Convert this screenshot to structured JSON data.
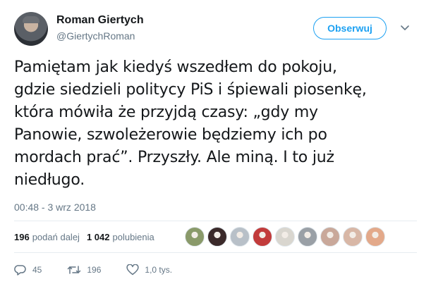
{
  "author": {
    "display_name": "Roman Giertych",
    "screen_name": "@GiertychRoman"
  },
  "follow_button": {
    "label": "Obserwuj"
  },
  "tweet": {
    "text": "Pamiętam jak kiedyś wszedłem do pokoju,\ngdzie siedzieli politycy PiS i śpiewali piosenkę,\nktóra mówiła że przyjdą czasy: „gdy my\nPanowie, szwoleżerowie będziemy ich po\nmordach prać”. Przyszły. Ale miną. I to już\nniedługo.",
    "timestamp": "00:48 - 3 wrz 2018"
  },
  "stats": {
    "retweets_count": "196",
    "retweets_label": "podań dalej",
    "likes_count": "1 042",
    "likes_label": "polubienia"
  },
  "likers": [
    {
      "color": "#8a9a6a"
    },
    {
      "color": "#3b2a2a"
    },
    {
      "color": "#b8c0c8"
    },
    {
      "color": "#c23b3b"
    },
    {
      "color": "#d9d6cf"
    },
    {
      "color": "#9aa0a6"
    },
    {
      "color": "#c9a89a"
    },
    {
      "color": "#d8b7a6"
    },
    {
      "color": "#e3a98a"
    }
  ],
  "actions": {
    "reply_icon": "reply-icon",
    "reply_count": "45",
    "retweet_icon": "retweet-icon",
    "retweet_count": "196",
    "like_icon": "heart-icon",
    "like_count": "1,0 tys."
  },
  "colors": {
    "accent": "#1da1f2",
    "secondary_text": "#657786",
    "primary_text": "#14171a",
    "divider": "#e6ecf0"
  }
}
